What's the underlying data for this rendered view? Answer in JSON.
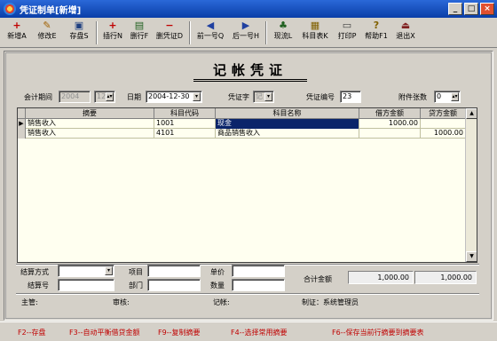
{
  "window": {
    "title": "凭证制单[新增]"
  },
  "toolbar": [
    {
      "label": "新增A",
      "icon": "plus-icon",
      "glyph": "+",
      "color": "#c00000"
    },
    {
      "label": "修改E",
      "icon": "edit-icon",
      "glyph": "✎",
      "color": "#a06000"
    },
    {
      "label": "存盘S",
      "icon": "save-icon",
      "glyph": "▣",
      "color": "#204080"
    },
    {
      "label": "插行N",
      "icon": "insert-row-icon",
      "glyph": "+",
      "color": "#c00000"
    },
    {
      "label": "删行F",
      "icon": "delete-row-icon",
      "glyph": "▤",
      "color": "#206020"
    },
    {
      "label": "删凭证D",
      "icon": "delete-voucher-icon",
      "glyph": "−",
      "color": "#c00000"
    },
    {
      "label": "前一号Q",
      "icon": "arrow-left-icon",
      "glyph": "◀",
      "color": "#2040a0"
    },
    {
      "label": "后一号H",
      "icon": "arrow-right-icon",
      "glyph": "▶",
      "color": "#2040a0"
    },
    {
      "label": "现流L",
      "icon": "cashflow-icon",
      "glyph": "♣",
      "color": "#206020"
    },
    {
      "label": "科目表K",
      "icon": "account-table-icon",
      "glyph": "▦",
      "color": "#806000"
    },
    {
      "label": "打印P",
      "icon": "print-icon",
      "glyph": "▭",
      "color": "#404040"
    },
    {
      "label": "帮助F1",
      "icon": "help-icon",
      "glyph": "?",
      "color": "#806000"
    },
    {
      "label": "退出X",
      "icon": "exit-icon",
      "glyph": "⏏",
      "color": "#802020"
    }
  ],
  "voucher": {
    "title": "记帐凭证",
    "period_label": "会计期间",
    "period_year": "2004",
    "period_month": "12",
    "date_label": "日期",
    "date_value": "2004-12-30",
    "type_label": "凭证字",
    "type_value": "记",
    "number_label": "凭证编号",
    "number_value": "23",
    "attach_label": "附件张数",
    "attach_value": "0"
  },
  "grid": {
    "headers": [
      "摘要",
      "科目代码",
      "科目名称",
      "借方金额",
      "贷方金额"
    ],
    "rows": [
      {
        "summary": "销售收入",
        "code": "1001",
        "name": "现金",
        "debit": "1000.00",
        "credit": ""
      },
      {
        "summary": "销售收入",
        "code": "4101",
        "name": "商品销售收入",
        "debit": "",
        "credit": "1000.00"
      }
    ]
  },
  "footer": {
    "settle_method_label": "结算方式",
    "settle_no_label": "结算号",
    "project_label": "项目",
    "dept_label": "部门",
    "price_label": "单价",
    "qty_label": "数量",
    "total_label": "合计金额",
    "total_debit": "1,000.00",
    "total_credit": "1,000.00",
    "supervisor_label": "主管:",
    "auditor_label": "审核:",
    "bookkeeper_label": "记帐:",
    "maker_label": "制证：系统管理员"
  },
  "hotkeys": [
    "F2--存盘",
    "F3--自动平衡借贷金额",
    "F9--复制摘要",
    "F4--选择常用摘要",
    "F6--保存当前行摘要到摘要表"
  ],
  "colors": {
    "selection": "#0a246a",
    "hotkey_text": "#c00000",
    "grid_bg": "#fffff0"
  }
}
